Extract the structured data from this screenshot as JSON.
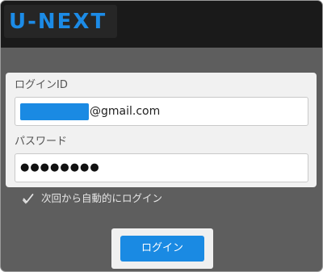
{
  "header": {
    "logo_text": "U-NEXT"
  },
  "form": {
    "id_label": "ログインID",
    "id_value_visible": "@gmail.com",
    "password_label": "パスワード",
    "password_masked": "●●●●●●●●"
  },
  "auto_login": {
    "label": "次回から自動的にログイン",
    "checked": true
  },
  "login_button": {
    "label": "ログイン"
  },
  "colors": {
    "accent": "#1a8ae3",
    "header_bg": "#1a1a1a",
    "page_bg": "#5e5e5e",
    "card_bg": "#f1f1f1"
  },
  "icons": {
    "check": "check-icon"
  }
}
